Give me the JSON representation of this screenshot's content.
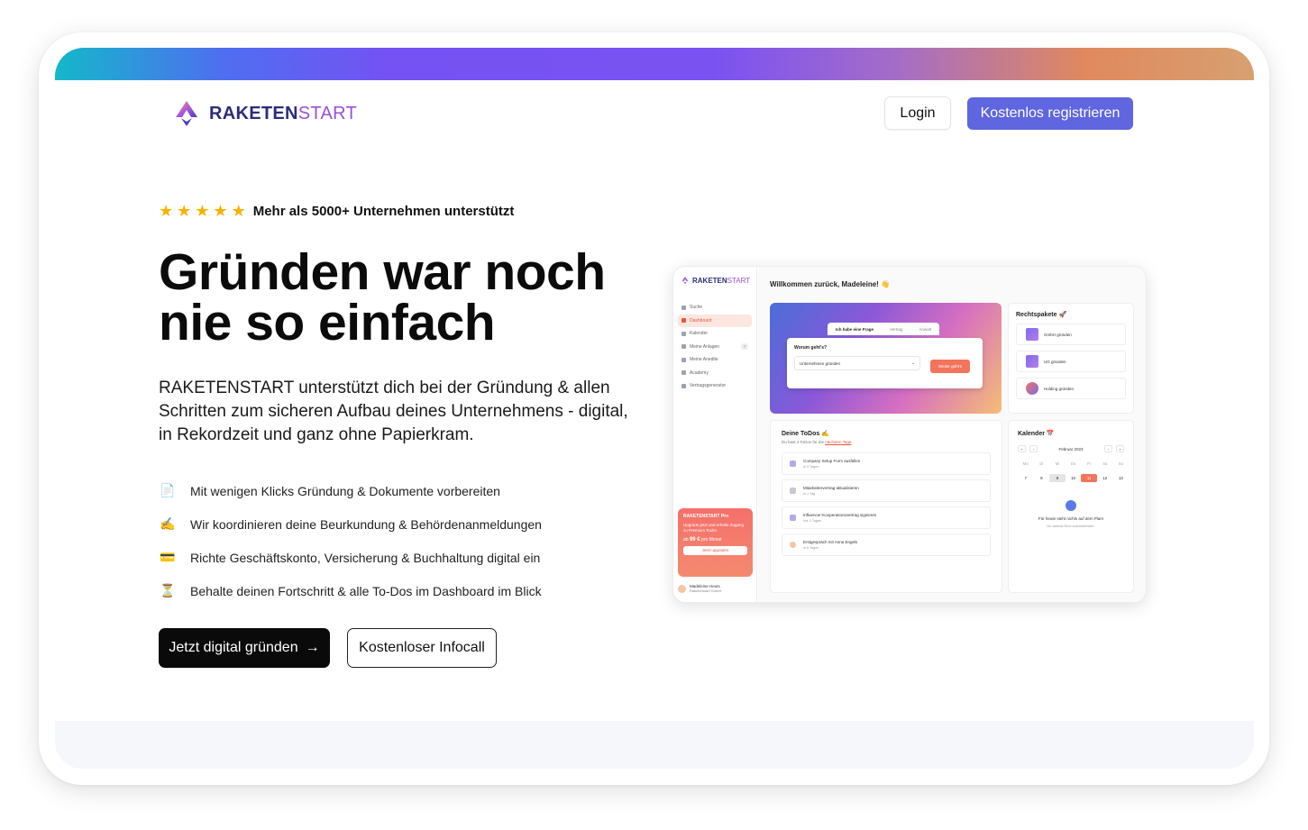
{
  "brand": {
    "name_bold": "RAKETEN",
    "name_light": "START"
  },
  "header": {
    "login_label": "Login",
    "register_label": "Kostenlos registrieren"
  },
  "hero": {
    "rating_text": "Mehr als 5000+ Unternehmen unterstützt",
    "title_line1": "Gründen war noch",
    "title_line2": "nie so einfach",
    "subtitle": "RAKETENSTART unterstützt dich bei der Gründung & allen Schritten zum sicheren Aufbau deines Unternehmens - digital, in Rekordzeit und ganz ohne Papierkram.",
    "features": [
      {
        "icon": "document-icon",
        "emoji": "📄",
        "text": "Mit wenigen Klicks Gründung & Dokumente vorbereiten"
      },
      {
        "icon": "writing-hand-icon",
        "emoji": "✍️",
        "text": "Wir koordinieren deine Beurkundung & Behördenanmeldungen"
      },
      {
        "icon": "credit-card-icon",
        "emoji": "💳",
        "text": "Richte Geschäftskonto, Versicherung & Buchhaltung digital ein"
      },
      {
        "icon": "hourglass-icon",
        "emoji": "⏳",
        "text": "Behalte deinen Fortschritt & alle To-Dos im Dashboard im Blick"
      }
    ],
    "cta_primary": "Jetzt digital gründen",
    "cta_primary_arrow": "→",
    "cta_secondary": "Kostenloser Infocall"
  },
  "dashboard": {
    "logo_bold": "RAKETEN",
    "logo_light": "START",
    "nav": [
      {
        "label": "Suche",
        "active": false
      },
      {
        "label": "Dashboard",
        "active": true
      },
      {
        "label": "Kalender",
        "active": false
      },
      {
        "label": "Meine Anlagen",
        "active": false,
        "badge": "7"
      },
      {
        "label": "Meine Anedite",
        "active": false
      },
      {
        "label": "Academy",
        "active": false
      },
      {
        "label": "Vertragsgenerator",
        "active": false
      }
    ],
    "promo": {
      "title": "RAKETENSTART Pro",
      "text": "Upgrade jetzt und erhalte Zugang zu Premium Tools!",
      "price_prefix": "ab",
      "price": "99 €",
      "price_suffix": "pro Monat",
      "button": "Jetzt upgraden"
    },
    "user": {
      "name": "Madeleine Heuts",
      "company": "Raketenstart GmbH"
    },
    "welcome": "Willkommen zurück, Madeleine! 👋",
    "tabs": [
      "Ich habe eine Frage",
      "Vertrag",
      "Anwalt"
    ],
    "question_label": "Worum geht's?",
    "select_value": "Unternehmen gründen",
    "go_button": "Weiter geht's",
    "rechtspakete": {
      "title": "Rechtspakete 🚀",
      "items": [
        "GmbH gründen",
        "UG gründen",
        "Holding gründen"
      ]
    },
    "todos": {
      "title": "Deine ToDos ✍️",
      "subtitle_prefix": "Du hast 4 ToDos für die",
      "subtitle_link": "nächsten Tage",
      "items": [
        {
          "label": "Company Setup Form ausfüllen",
          "due": "in 3 Tagen"
        },
        {
          "label": "Mitarbeitervertrag aktualisieren",
          "due": "in 1 Tag"
        },
        {
          "label": "Influencer-Kooperationsvertrag signieren",
          "due": "Vor 2 Tagen"
        },
        {
          "label": "Erstgespräch mit Anna Engels",
          "due": "in 5 Tagen"
        }
      ]
    },
    "calendar": {
      "title": "Kalender 📅",
      "month": "Februar 2023",
      "weekdays": [
        "Mo",
        "Di",
        "Mi",
        "Do",
        "Fr",
        "Sa",
        "So"
      ],
      "days": [
        "7",
        "8",
        "9",
        "10",
        "11",
        "12",
        "13"
      ],
      "today": "9",
      "selected": "11",
      "empty_title": "Für heute steht nichts auf dem Plan!",
      "empty_sub": "Du kannst Dich zurücklehnen."
    }
  }
}
